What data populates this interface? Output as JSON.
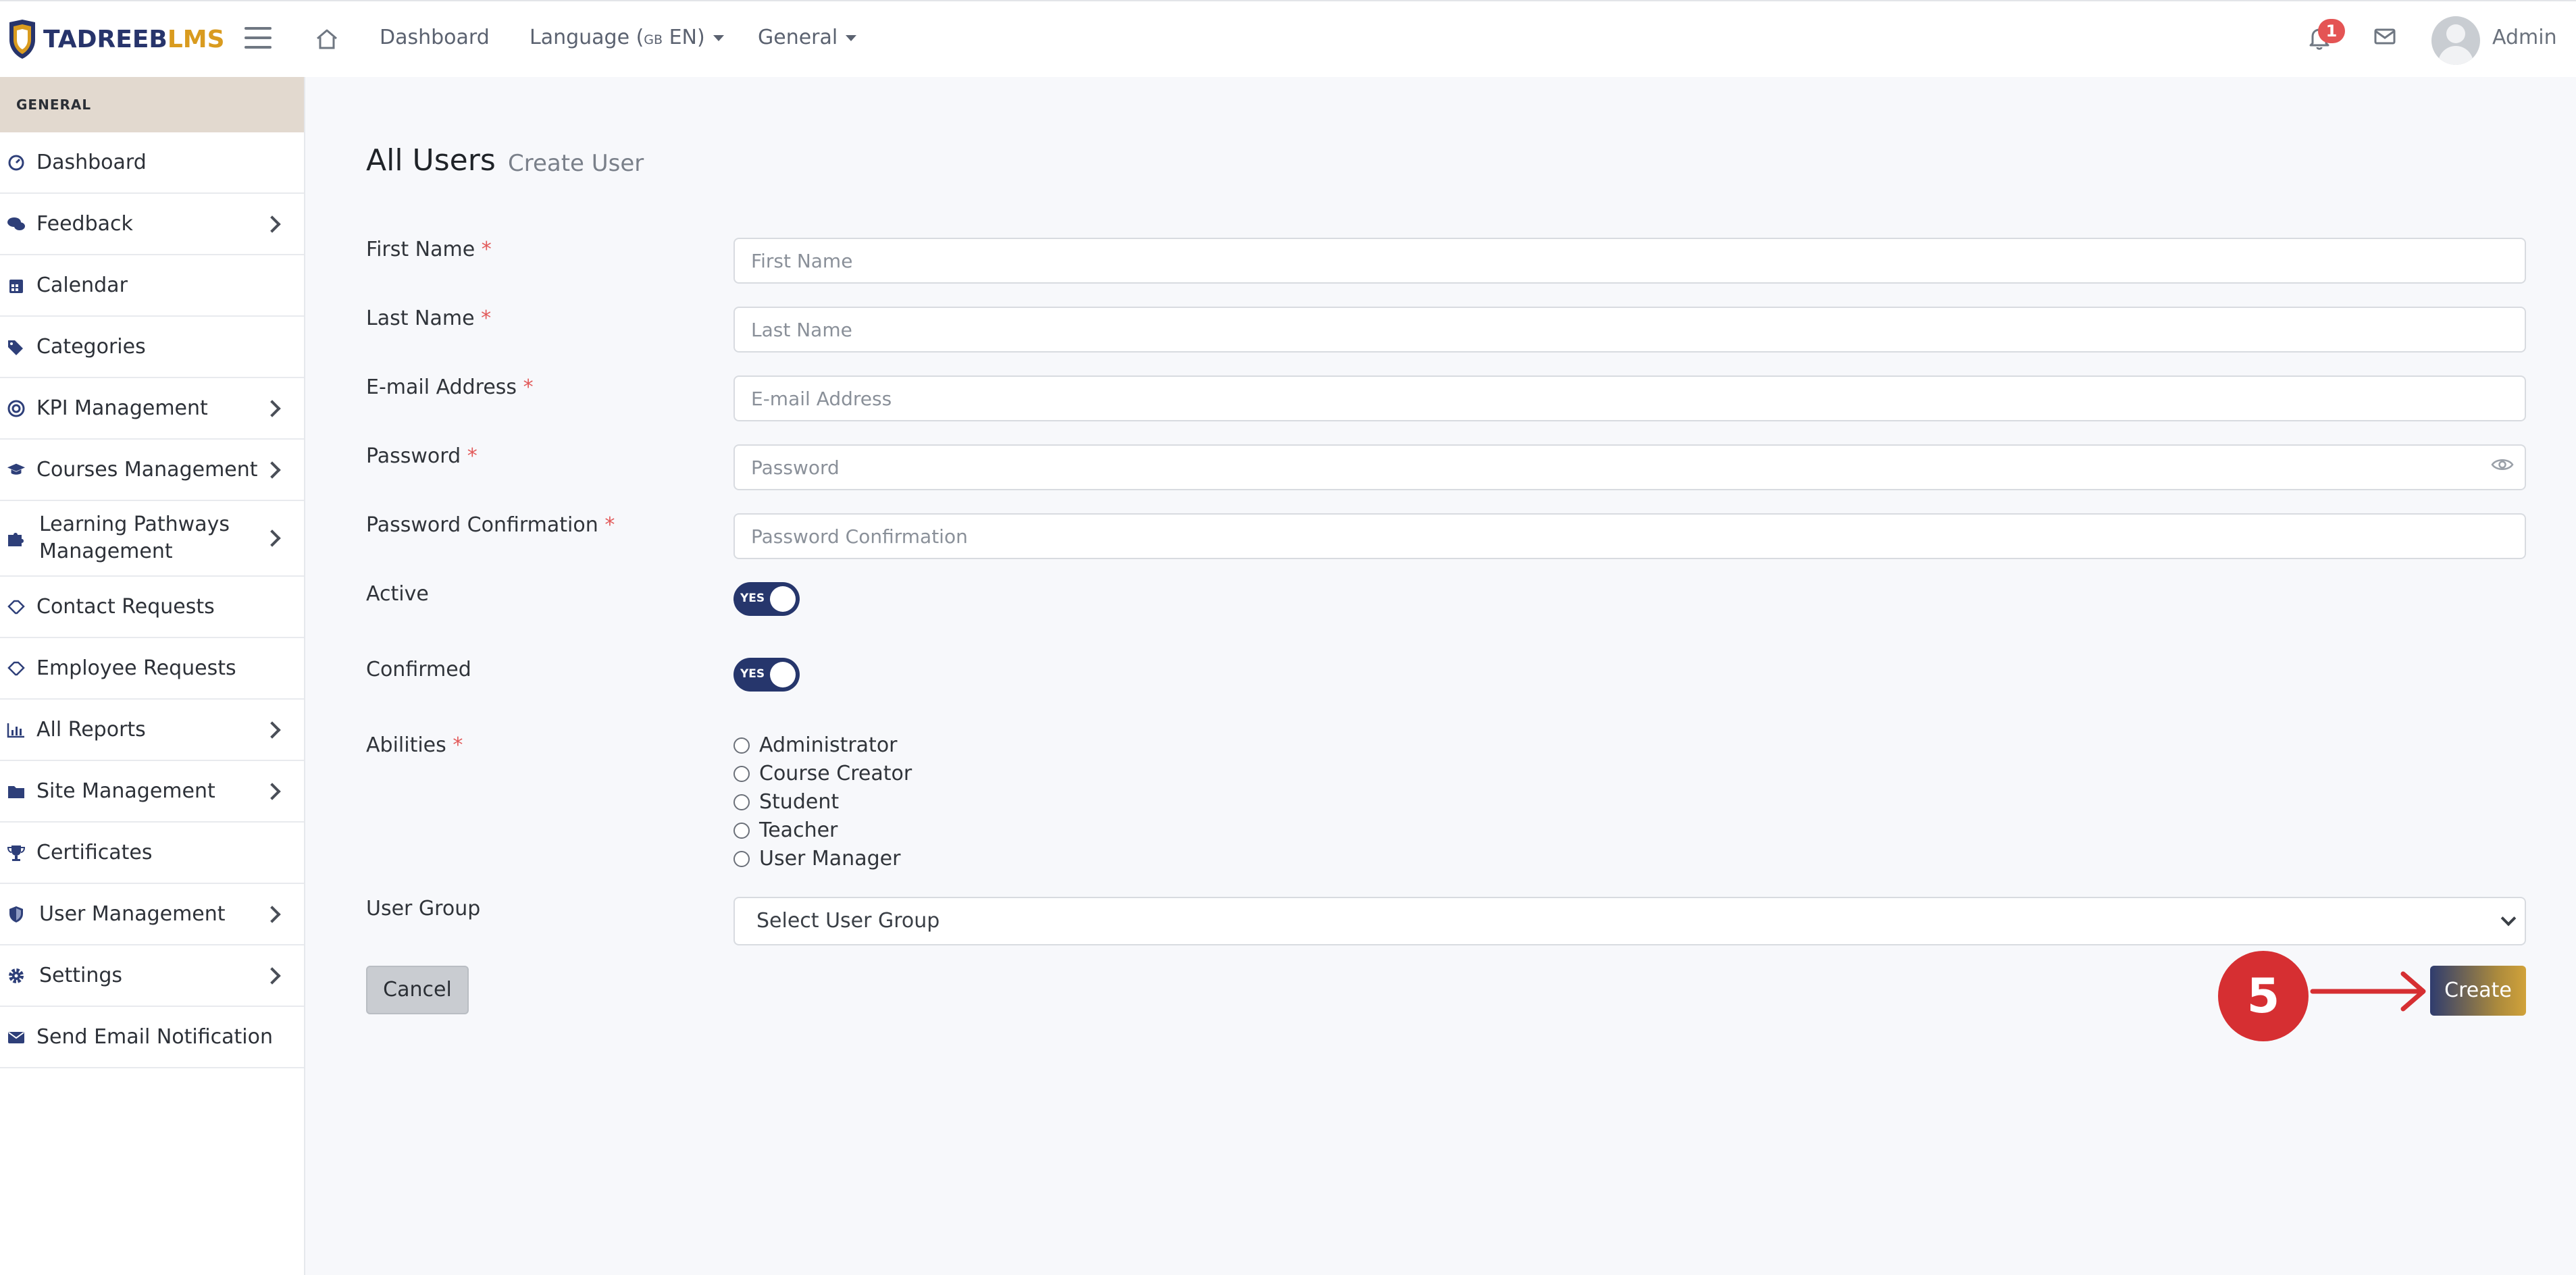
{
  "brand": {
    "name_part1": "TADREEB",
    "name_part2": "LMS"
  },
  "topnav": {
    "dashboard": "Dashboard",
    "language_label": "Language (",
    "language_flag": "GB",
    "language_code": " EN)",
    "general": "General"
  },
  "notifications": {
    "count": "1"
  },
  "user": {
    "name": "Admin"
  },
  "sidebar": {
    "header": "GENERAL",
    "items": [
      {
        "label": "Dashboard",
        "icon": "gauge-icon",
        "has_submenu": false
      },
      {
        "label": "Feedback",
        "icon": "comments-icon",
        "has_submenu": true
      },
      {
        "label": "Calendar",
        "icon": "calendar-icon",
        "has_submenu": false
      },
      {
        "label": "Categories",
        "icon": "tags-icon",
        "has_submenu": false
      },
      {
        "label": "KPI Management",
        "icon": "target-icon",
        "has_submenu": true
      },
      {
        "label": "Courses Management",
        "icon": "graduation-cap-icon",
        "has_submenu": true
      },
      {
        "label": "Learning Pathways Management",
        "icon": "puzzle-icon",
        "has_submenu": true
      },
      {
        "label": "Contact Requests",
        "icon": "handshake-icon",
        "has_submenu": false
      },
      {
        "label": "Employee Requests",
        "icon": "handshake-icon",
        "has_submenu": false
      },
      {
        "label": "All Reports",
        "icon": "bar-chart-icon",
        "has_submenu": true
      },
      {
        "label": "Site Management",
        "icon": "folder-icon",
        "has_submenu": true
      },
      {
        "label": "Certificates",
        "icon": "trophy-icon",
        "has_submenu": false
      },
      {
        "label": "User Management",
        "icon": "shield-icon",
        "has_submenu": true
      },
      {
        "label": "Settings",
        "icon": "gear-icon",
        "has_submenu": true
      },
      {
        "label": "Send Email Notification",
        "icon": "envelope-icon",
        "has_submenu": false
      }
    ]
  },
  "page": {
    "title": "All Users",
    "subtitle": "Create User"
  },
  "form": {
    "first_name": {
      "label": "First Name",
      "placeholder": "First Name",
      "value": ""
    },
    "last_name": {
      "label": "Last Name",
      "placeholder": "Last Name",
      "value": ""
    },
    "email": {
      "label": "E-mail Address",
      "placeholder": "E-mail Address",
      "value": ""
    },
    "password": {
      "label": "Password",
      "placeholder": "Password",
      "value": ""
    },
    "password_confirmation": {
      "label": "Password Confirmation",
      "placeholder": "Password Confirmation",
      "value": ""
    },
    "active": {
      "label": "Active",
      "toggle_text": "YES",
      "checked": true
    },
    "confirmed": {
      "label": "Confirmed",
      "toggle_text": "YES",
      "checked": true
    },
    "abilities": {
      "label": "Abilities",
      "options": [
        "Administrator",
        "Course Creator",
        "Student",
        "Teacher",
        "User Manager"
      ]
    },
    "user_group": {
      "label": "User Group",
      "selected": "Select User Group"
    },
    "required_mark": "*",
    "cancel_label": "Cancel",
    "create_label": "Create"
  },
  "annotation": {
    "step_number": "5",
    "color": "#d62f32"
  },
  "colors": {
    "primary": "#26366c",
    "gold": "#d99b1f",
    "sidebar_header": "#e2d9cf",
    "badge": "#e45454"
  }
}
